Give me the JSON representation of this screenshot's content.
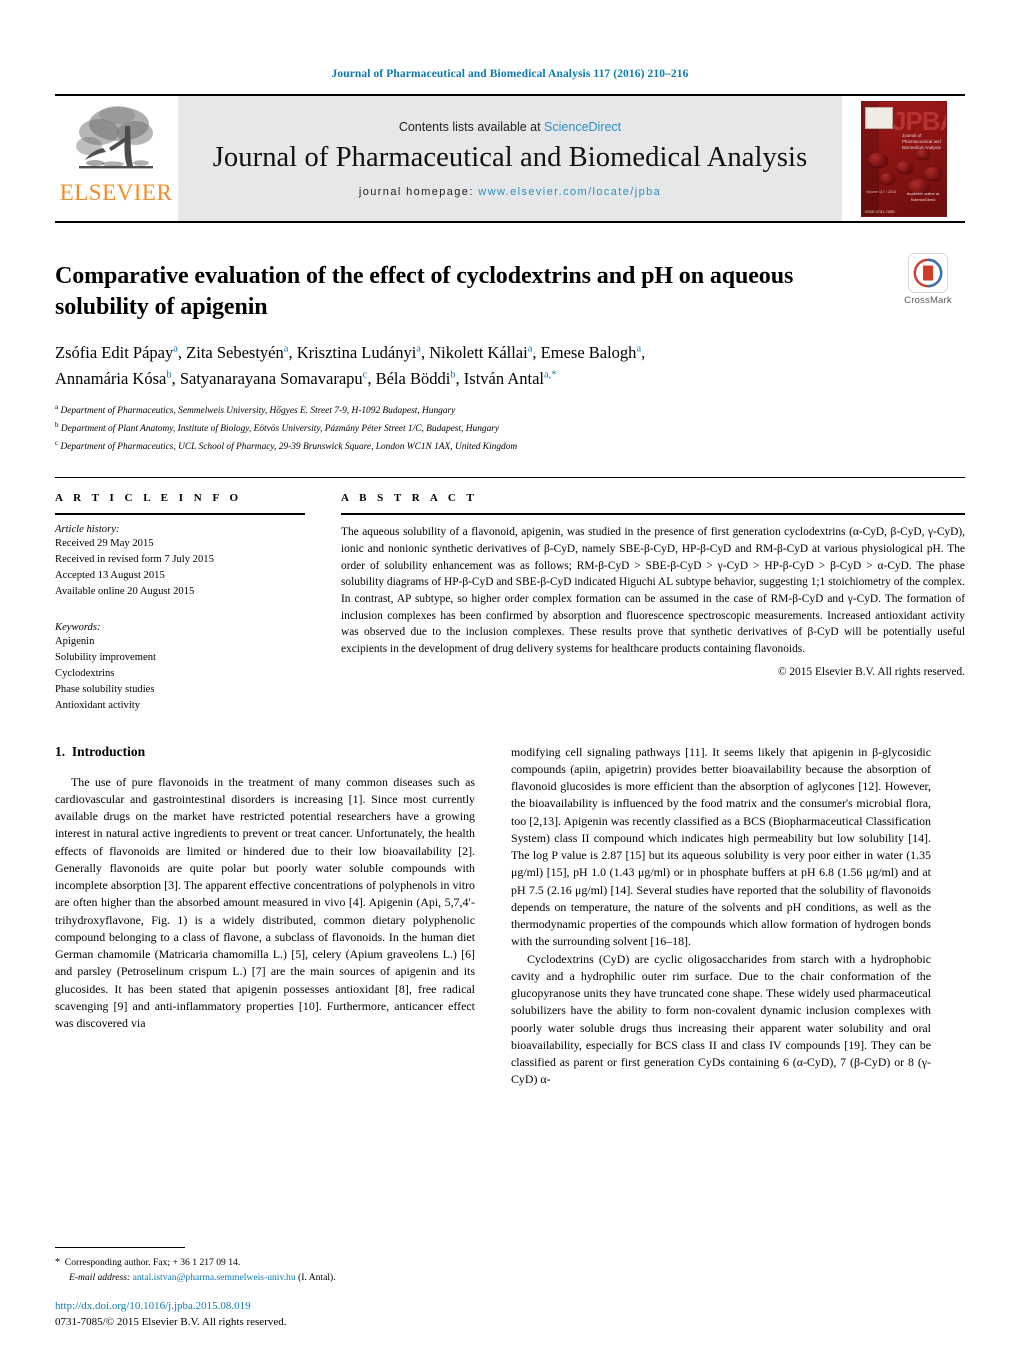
{
  "running_head": "Journal of Pharmaceutical and Biomedical Analysis 117 (2016) 210–216",
  "masthead": {
    "publisher_wordmark": "ELSEVIER",
    "contents_prefix": "Contents lists available at ",
    "contents_link": "ScienceDirect",
    "journal_title": "Journal of Pharmaceutical and Biomedical Analysis",
    "homepage_prefix": "journal homepage: ",
    "homepage_url": "www.elsevier.com/locate/jpba",
    "cover": {
      "acronym": "JPBA",
      "subtitle": "Journal of Pharmaceutical and Biomedical Analysis",
      "meta": "Volume 117 • 2016",
      "sciencedirect": "Available online at ScienceDirect",
      "issn": "ISSN 0731-7085"
    }
  },
  "article": {
    "title": "Comparative evaluation of the effect of cyclodextrins and pH on aqueous solubility of apigenin",
    "crossmark_label": "CrossMark",
    "authors_line_1": "Zsófia Edit Pápay",
    "authors": [
      {
        "name": "Zsófia Edit Pápay",
        "sup": "a"
      },
      {
        "name": "Zita Sebestyén",
        "sup": "a"
      },
      {
        "name": "Krisztina Ludányi",
        "sup": "a"
      },
      {
        "name": "Nikolett Kállai",
        "sup": "a"
      },
      {
        "name": "Emese Balogh",
        "sup": "a"
      },
      {
        "name": "Annamária Kósa",
        "sup": "b"
      },
      {
        "name": "Satyanarayana Somavarapu",
        "sup": "c"
      },
      {
        "name": "Béla Böddi",
        "sup": "b"
      },
      {
        "name": "István Antal",
        "sup": "a,*"
      }
    ],
    "affiliations": [
      {
        "sup": "a",
        "text": "Department of Pharmaceutics, Semmelweis University, Hőgyes E. Street 7-9, H-1092 Budapest, Hungary"
      },
      {
        "sup": "b",
        "text": "Department of Plant Anatomy, Institute of Biology, Eötvös University, Pázmány Péter Street 1/C, Budapest, Hungary"
      },
      {
        "sup": "c",
        "text": "Department of Pharmaceutics, UCL School of Pharmacy, 29-39 Brunswick Square, London WC1N 1AX, United Kingdom"
      }
    ]
  },
  "article_info": {
    "heading": "A R T I C L E   I N F O",
    "history_label": "Article history:",
    "history": [
      "Received 29 May 2015",
      "Received in revised form 7 July 2015",
      "Accepted 13 August 2015",
      "Available online 20 August 2015"
    ],
    "keywords_label": "Keywords:",
    "keywords": [
      "Apigenin",
      "Solubility improvement",
      "Cyclodextrins",
      "Phase solubility studies",
      "Antioxidant activity"
    ]
  },
  "abstract": {
    "heading": "A B S T R A C T",
    "text": "The aqueous solubility of a flavonoid, apigenin, was studied in the presence of first generation cyclodextrins (α-CyD, β-CyD, γ-CyD), ionic and nonionic synthetic derivatives of β-CyD, namely SBE-β-CyD, HP-β-CyD and RM-β-CyD at various physiological pH. The order of solubility enhancement was as follows; RM-β-CyD > SBE-β-CyD > γ-CyD > HP-β-CyD > β-CyD > α-CyD. The phase solubility diagrams of HP-β-CyD and SBE-β-CyD indicated Higuchi AL subtype behavior, suggesting 1;1 stoichiometry of the complex. In contrast, AP subtype, so higher order complex formation can be assumed in the case of RM-β-CyD and γ-CyD. The formation of inclusion complexes has been confirmed by absorption and fluorescence spectroscopic measurements. Increased antioxidant activity was observed due to the inclusion complexes. These results prove that synthetic derivatives of β-CyD will be potentially useful excipients in the development of drug delivery systems for healthcare products containing flavonoids.",
    "copyright": "© 2015 Elsevier B.V. All rights reserved."
  },
  "introduction": {
    "section_number": "1.",
    "section_title": "Introduction",
    "left_paragraphs": [
      "The use of pure flavonoids in the treatment of many common diseases such as cardiovascular and gastrointestinal disorders is increasing [1]. Since most currently available drugs on the market have restricted potential researchers have a growing interest in natural active ingredients to prevent or treat cancer. Unfortunately, the health effects of flavonoids are limited or hindered due to their low bioavailability [2]. Generally flavonoids are quite polar but poorly water soluble compounds with incomplete absorption [3]. The apparent effective concentrations of polyphenols in vitro are often higher than the absorbed amount measured in vivo [4]. Apigenin (Api, 5,7,4′-trihydroxyflavone, Fig. 1) is a widely distributed, common dietary polyphenolic compound belonging to a class of flavone, a subclass of flavonoids. In the human diet German chamomile (Matricaria chamomilla L.) [5], celery (Apium graveolens L.) [6] and parsley (Petroselinum crispum L.) [7] are the main sources of apigenin and its glucosides. It has been stated that apigenin possesses antioxidant [8], free radical scavenging [9] and anti-inflammatory properties [10]. Furthermore, anticancer effect was discovered via"
    ],
    "right_paragraphs": [
      "modifying cell signaling pathways [11]. It seems likely that apigenin in β-glycosidic compounds (apiin, apigetrin) provides better bioavailability because the absorption of flavonoid glucosides is more efficient than the absorption of aglycones [12]. However, the bioavailability is influenced by the food matrix and the consumer's microbial flora, too [2,13]. Apigenin was recently classified as a BCS (Biopharmaceutical Classification System) class II compound which indicates high permeability but low solubility [14]. The log P value is 2.87 [15] but its aqueous solubility is very poor either in water (1.35 μg/ml) [15], pH 1.0 (1.43 μg/ml) or in phosphate buffers at pH 6.8 (1.56 μg/ml) and at pH 7.5 (2.16 μg/ml) [14]. Several studies have reported that the solubility of flavonoids depends on temperature, the nature of the solvents and pH conditions, as well as the thermodynamic properties of the compounds which allow formation of hydrogen bonds with the surrounding solvent [16–18].",
      "Cyclodextrins (CyD) are cyclic oligosaccharides from starch with a hydrophobic cavity and a hydrophilic outer rim surface. Due to the chair conformation of the glucopyranose units they have truncated cone shape. These widely used pharmaceutical solubilizers have the ability to form non-covalent dynamic inclusion complexes with poorly water soluble drugs thus increasing their apparent water solubility and oral bioavailability, especially for BCS class II and class IV compounds [19]. They can be classified as parent or first generation CyDs containing 6 (α-CyD), 7 (β-CyD) or 8 (γ-CyD) α-"
    ]
  },
  "footnotes": {
    "corresponding": "Corresponding author. Fax; + 36 1 217 09 14.",
    "email_label": "E-mail address:",
    "email": "antal.istvan@pharma.semmelweis-univ.hu",
    "email_suffix": "(I. Antal)."
  },
  "doc_footer": {
    "doi": "http://dx.doi.org/10.1016/j.jpba.2015.08.019",
    "issn_line": "0731-7085/© 2015 Elsevier B.V. All rights reserved."
  },
  "colors": {
    "link": "#0c7ab0",
    "elsevier_orange": "#F28C28",
    "masthead_grey": "#e6e7e9",
    "cover_red": "#8d1414"
  }
}
